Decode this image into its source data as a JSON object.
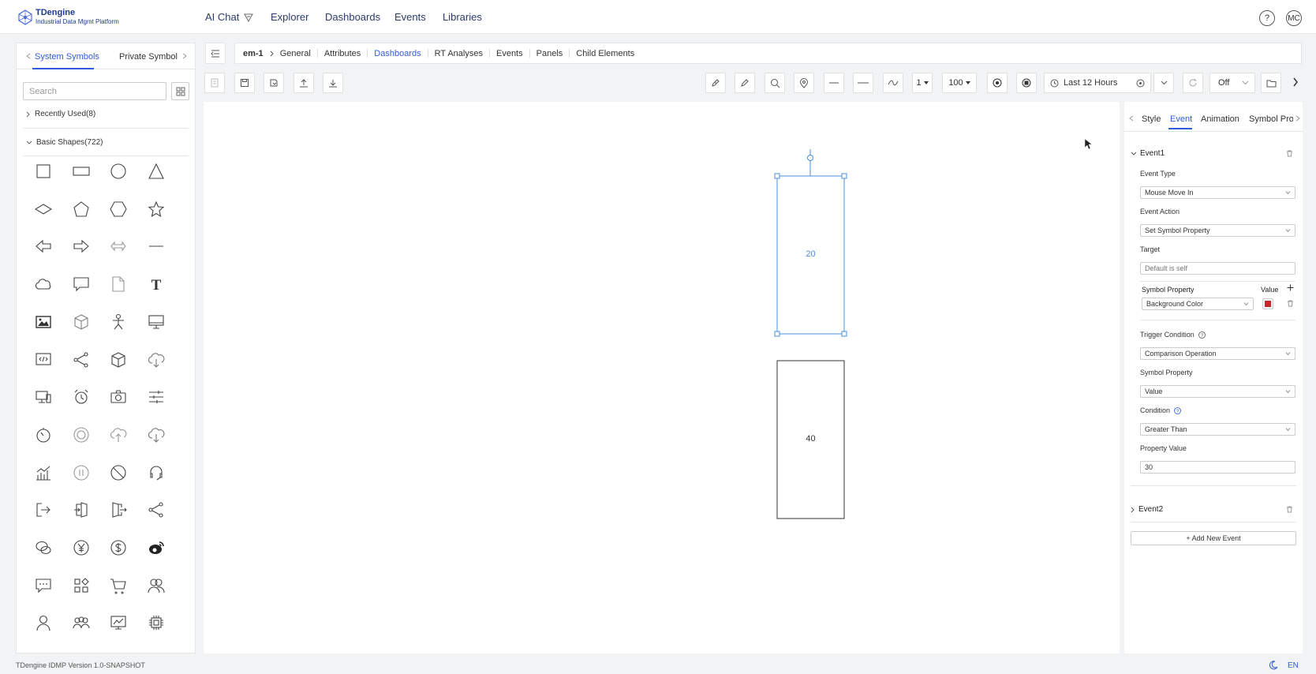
{
  "logo": {
    "name": "TDengine",
    "subtitle": "Industrial Data Mgmt Platform"
  },
  "nav": [
    "AI Chat",
    "Explorer",
    "Dashboards",
    "Events",
    "Libraries"
  ],
  "header": {
    "help": "?",
    "avatar": "MC"
  },
  "left_panel": {
    "tabs": [
      "System Symbols",
      "Private Symbols"
    ],
    "active_tab": "System Symbols",
    "search_placeholder": "Search",
    "recent_group": "Recently Used(8)",
    "basic_group": "Basic Shapes(722)",
    "shape_icons": [
      "square-shape",
      "rectangle-shape",
      "circle-shape",
      "triangle-shape",
      "diamond-shape",
      "pentagon-shape",
      "hexagon-shape",
      "star-shape",
      "left-arrow-shape",
      "right-arrow-shape",
      "double-arrow-shape",
      "line-shape",
      "cloud-shape",
      "callout-shape",
      "document-shape",
      "text-shape",
      "image-shape",
      "cube-shape",
      "person-shape",
      "monitor-shape",
      "code-screen-shape",
      "share-shape",
      "box-shape",
      "cloud-download-shape",
      "desktop-shape",
      "alarm-clock-shape",
      "camera-shape",
      "sliders-shape",
      "timer-shape",
      "refresh-shape",
      "cloud-upload-shape",
      "cloud-down-shape",
      "chart-shape",
      "pause-shape",
      "forbidden-shape",
      "headset-shape",
      "exit-shape",
      "door-enter-shape",
      "door-exit-shape",
      "network-shape",
      "wechat-shape",
      "yen-shape",
      "dollar-shape",
      "weibo-shape",
      "message-shape",
      "apps-shape",
      "cart-shape",
      "users-shape",
      "user-shape",
      "group-shape",
      "monitor-chart-shape",
      "chip-shape"
    ]
  },
  "breadcrumb": {
    "root": "em-1",
    "tabs": [
      "General",
      "Attributes",
      "Dashboards",
      "RT Analyses",
      "Events",
      "Panels",
      "Child Elements"
    ],
    "active": "Dashboards"
  },
  "toolbar": {
    "line_width": "1",
    "zoom": "100",
    "time_range": "Last 12 Hours",
    "refresh": "Off"
  },
  "canvas": {
    "symbol1_value": "20",
    "symbol2_value": "40"
  },
  "right_panel": {
    "tabs": [
      "Style",
      "Event",
      "Animation",
      "Symbol Pro"
    ],
    "active_tab": "Event",
    "event1": {
      "title": "Event1",
      "event_type_label": "Event Type",
      "event_type": "Mouse Move In",
      "event_action_label": "Event Action",
      "event_action": "Set Symbol Property",
      "target_label": "Target",
      "target_placeholder": "Default is self",
      "symbol_property_label": "Symbol Property",
      "value_label": "Value",
      "symbol_property": "Background Color",
      "color_value": "#c9252c",
      "trigger_label": "Trigger Condition",
      "trigger": "Comparison Operation",
      "symbol_property2_label": "Symbol Property",
      "symbol_property2": "Value",
      "condition_label": "Condition",
      "condition": "Greater Than",
      "property_value_label": "Property Value",
      "property_value": "30"
    },
    "event2": {
      "title": "Event2"
    },
    "add_event": "+ Add New Event"
  },
  "footer": {
    "version": "TDengine IDMP Version 1.0-SNAPSHOT",
    "lang": "EN"
  },
  "colors": {
    "accent": "#2f5bd8",
    "selection": "#4a8fe0",
    "danger": "#c9252c"
  }
}
